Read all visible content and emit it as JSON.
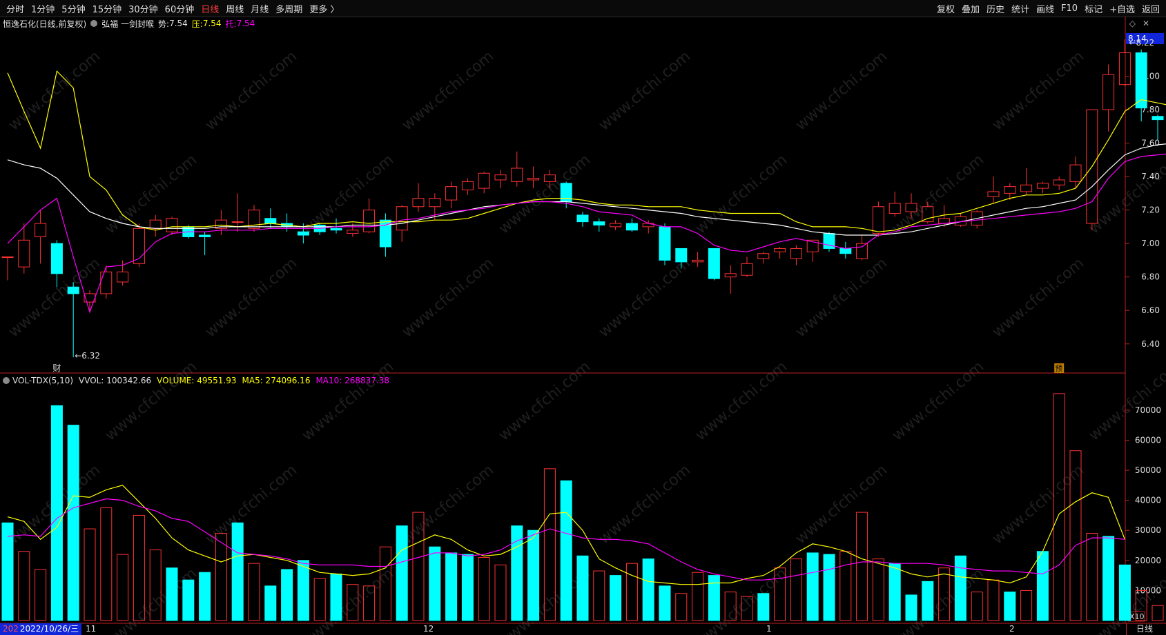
{
  "toolbar": {
    "left": [
      {
        "label": "分时"
      },
      {
        "label": "1分钟"
      },
      {
        "label": "5分钟"
      },
      {
        "label": "15分钟"
      },
      {
        "label": "30分钟"
      },
      {
        "label": "60分钟"
      },
      {
        "label": "日线",
        "active": true
      },
      {
        "label": "周线"
      },
      {
        "label": "月线"
      },
      {
        "label": "多周期"
      },
      {
        "label": "更多 〉"
      }
    ],
    "right": [
      {
        "label": "复权"
      },
      {
        "label": "叠加"
      },
      {
        "label": "历史"
      },
      {
        "label": "统计"
      },
      {
        "label": "画线"
      },
      {
        "label": "F10"
      },
      {
        "label": "标记"
      },
      {
        "label": "+自选"
      },
      {
        "label": "返回"
      }
    ]
  },
  "info": {
    "stock_title": "恒逸石化(日线,前复权)",
    "indicator": "弘福 一剑封喉",
    "shi_label": "势:",
    "shi_value": "7.54",
    "ya_label": "压:",
    "ya_value": "7.54",
    "tuo_label": "托:",
    "tuo_value": "7.54"
  },
  "volume_info": {
    "name": "VOL-TDX(5,10)",
    "vvol": "VVOL: 100342.66",
    "volume": "VOLUME: 49551.93",
    "ma5": "MA5: 274096.16",
    "ma10": "MA10: 268837.38"
  },
  "current_price": "8.14",
  "markers": {
    "high_label": "8.22",
    "low_label": "6.32",
    "cai_label": "财",
    "yu_label": "预"
  },
  "volume_unit": "X10",
  "date_strip": {
    "flag": "2022/10/26/三",
    "m_nov": "11",
    "m_dec": "12",
    "m_jan": "1",
    "m_feb": "2",
    "prefix": "202"
  },
  "period_label": "日线",
  "watermark": "www.cfchi.com",
  "colors": {
    "up": "#ff3232",
    "down": "#00ffff",
    "ma_yellow": "#ffff00",
    "ma_white": "#ffffff",
    "ma_magenta": "#ff00ff",
    "axis": "#c02020",
    "accent_blue": "#1026d8"
  },
  "chart_data": [
    {
      "type": "candlestick",
      "title": "恒逸石化(日线,前复权)",
      "price_axis": {
        "ticks": [
          6.4,
          6.6,
          6.8,
          7.0,
          7.2,
          7.4,
          7.6,
          7.8,
          8.0
        ],
        "range": [
          6.23,
          8.27
        ]
      },
      "candles": [
        {
          "o": 6.92,
          "h": 6.92,
          "l": 6.78,
          "c": 6.92
        },
        {
          "o": 6.86,
          "h": 7.12,
          "l": 6.82,
          "c": 7.02
        },
        {
          "o": 7.04,
          "h": 7.2,
          "l": 6.88,
          "c": 7.12
        },
        {
          "o": 7.0,
          "h": 7.02,
          "l": 6.74,
          "c": 6.82
        },
        {
          "o": 6.74,
          "h": 6.77,
          "l": 6.32,
          "c": 6.7
        },
        {
          "o": 6.65,
          "h": 6.72,
          "l": 6.6,
          "c": 6.7
        },
        {
          "o": 6.7,
          "h": 6.87,
          "l": 6.67,
          "c": 6.83
        },
        {
          "o": 6.77,
          "h": 6.9,
          "l": 6.75,
          "c": 6.83
        },
        {
          "o": 6.88,
          "h": 7.12,
          "l": 6.86,
          "c": 7.09
        },
        {
          "o": 7.09,
          "h": 7.17,
          "l": 7.04,
          "c": 7.14
        },
        {
          "o": 7.07,
          "h": 7.16,
          "l": 7.05,
          "c": 7.15
        },
        {
          "o": 7.1,
          "h": 7.11,
          "l": 7.03,
          "c": 7.04
        },
        {
          "o": 7.05,
          "h": 7.07,
          "l": 6.93,
          "c": 7.04
        },
        {
          "o": 7.09,
          "h": 7.2,
          "l": 7.05,
          "c": 7.14
        },
        {
          "o": 7.13,
          "h": 7.3,
          "l": 7.07,
          "c": 7.13
        },
        {
          "o": 7.09,
          "h": 7.23,
          "l": 7.07,
          "c": 7.2
        },
        {
          "o": 7.15,
          "h": 7.21,
          "l": 7.09,
          "c": 7.12
        },
        {
          "o": 7.12,
          "h": 7.18,
          "l": 7.07,
          "c": 7.1
        },
        {
          "o": 7.07,
          "h": 7.12,
          "l": 7.0,
          "c": 7.05
        },
        {
          "o": 7.11,
          "h": 7.12,
          "l": 7.05,
          "c": 7.07
        },
        {
          "o": 7.09,
          "h": 7.15,
          "l": 7.06,
          "c": 7.08
        },
        {
          "o": 7.06,
          "h": 7.12,
          "l": 7.04,
          "c": 7.08
        },
        {
          "o": 7.07,
          "h": 7.27,
          "l": 7.06,
          "c": 7.2
        },
        {
          "o": 7.14,
          "h": 7.18,
          "l": 6.92,
          "c": 6.98
        },
        {
          "o": 7.08,
          "h": 7.23,
          "l": 7.01,
          "c": 7.22
        },
        {
          "o": 7.22,
          "h": 7.36,
          "l": 7.19,
          "c": 7.27
        },
        {
          "o": 7.22,
          "h": 7.3,
          "l": 7.14,
          "c": 7.27
        },
        {
          "o": 7.26,
          "h": 7.37,
          "l": 7.21,
          "c": 7.34
        },
        {
          "o": 7.32,
          "h": 7.39,
          "l": 7.29,
          "c": 7.37
        },
        {
          "o": 7.33,
          "h": 7.43,
          "l": 7.3,
          "c": 7.42
        },
        {
          "o": 7.38,
          "h": 7.44,
          "l": 7.33,
          "c": 7.41
        },
        {
          "o": 7.37,
          "h": 7.55,
          "l": 7.34,
          "c": 7.45
        },
        {
          "o": 7.38,
          "h": 7.46,
          "l": 7.33,
          "c": 7.39
        },
        {
          "o": 7.37,
          "h": 7.44,
          "l": 7.33,
          "c": 7.41
        },
        {
          "o": 7.36,
          "h": 7.37,
          "l": 7.21,
          "c": 7.25
        },
        {
          "o": 7.17,
          "h": 7.19,
          "l": 7.1,
          "c": 7.13
        },
        {
          "o": 7.13,
          "h": 7.15,
          "l": 7.07,
          "c": 7.11
        },
        {
          "o": 7.1,
          "h": 7.14,
          "l": 7.08,
          "c": 7.12
        },
        {
          "o": 7.12,
          "h": 7.15,
          "l": 7.07,
          "c": 7.08
        },
        {
          "o": 7.1,
          "h": 7.14,
          "l": 7.06,
          "c": 7.12
        },
        {
          "o": 7.1,
          "h": 7.12,
          "l": 6.87,
          "c": 6.9
        },
        {
          "o": 6.97,
          "h": 6.97,
          "l": 6.85,
          "c": 6.89
        },
        {
          "o": 6.89,
          "h": 6.95,
          "l": 6.86,
          "c": 6.9
        },
        {
          "o": 6.97,
          "h": 6.97,
          "l": 6.78,
          "c": 6.79
        },
        {
          "o": 6.8,
          "h": 6.87,
          "l": 6.7,
          "c": 6.82
        },
        {
          "o": 6.81,
          "h": 6.92,
          "l": 6.8,
          "c": 6.88
        },
        {
          "o": 6.91,
          "h": 6.95,
          "l": 6.88,
          "c": 6.94
        },
        {
          "o": 6.95,
          "h": 6.98,
          "l": 6.91,
          "c": 6.97
        },
        {
          "o": 6.91,
          "h": 6.99,
          "l": 6.87,
          "c": 6.97
        },
        {
          "o": 6.95,
          "h": 7.02,
          "l": 6.89,
          "c": 7.02
        },
        {
          "o": 7.06,
          "h": 7.07,
          "l": 6.95,
          "c": 6.97
        },
        {
          "o": 6.97,
          "h": 7.01,
          "l": 6.91,
          "c": 6.94
        },
        {
          "o": 6.91,
          "h": 7.05,
          "l": 6.9,
          "c": 7.0
        },
        {
          "o": 7.06,
          "h": 7.25,
          "l": 7.04,
          "c": 7.22
        },
        {
          "o": 7.18,
          "h": 7.31,
          "l": 7.16,
          "c": 7.24
        },
        {
          "o": 7.19,
          "h": 7.3,
          "l": 7.15,
          "c": 7.24
        },
        {
          "o": 7.13,
          "h": 7.25,
          "l": 7.12,
          "c": 7.22
        },
        {
          "o": 7.12,
          "h": 7.23,
          "l": 7.1,
          "c": 7.15
        },
        {
          "o": 7.11,
          "h": 7.18,
          "l": 7.1,
          "c": 7.16
        },
        {
          "o": 7.11,
          "h": 7.2,
          "l": 7.09,
          "c": 7.19
        },
        {
          "o": 7.28,
          "h": 7.4,
          "l": 7.24,
          "c": 7.31
        },
        {
          "o": 7.3,
          "h": 7.36,
          "l": 7.26,
          "c": 7.34
        },
        {
          "o": 7.31,
          "h": 7.45,
          "l": 7.29,
          "c": 7.35
        },
        {
          "o": 7.33,
          "h": 7.37,
          "l": 7.3,
          "c": 7.36
        },
        {
          "o": 7.35,
          "h": 7.4,
          "l": 7.32,
          "c": 7.38
        },
        {
          "o": 7.37,
          "h": 7.52,
          "l": 7.33,
          "c": 7.47
        },
        {
          "o": 7.12,
          "h": 7.8,
          "l": 7.08,
          "c": 7.8
        },
        {
          "o": 7.8,
          "h": 8.07,
          "l": 7.67,
          "c": 8.01
        },
        {
          "o": 7.95,
          "h": 8.22,
          "l": 7.94,
          "c": 8.14
        },
        {
          "o": 8.14,
          "h": 8.16,
          "l": 7.73,
          "c": 7.81
        },
        {
          "o": 7.76,
          "h": 7.77,
          "l": 7.62,
          "c": 7.74
        },
        {
          "o": 7.74,
          "h": 7.79,
          "l": 7.69,
          "c": 7.74
        }
      ],
      "ma_yellow": [
        8.02,
        7.79,
        7.57,
        8.03,
        7.93,
        7.4,
        7.32,
        7.17,
        7.1,
        7.08,
        7.1,
        7.1,
        7.1,
        7.11,
        7.1,
        7.11,
        7.12,
        7.11,
        7.1,
        7.12,
        7.12,
        7.13,
        7.12,
        7.13,
        7.13,
        7.13,
        7.14,
        7.14,
        7.15,
        7.18,
        7.21,
        7.24,
        7.26,
        7.27,
        7.27,
        7.26,
        7.24,
        7.23,
        7.23,
        7.22,
        7.22,
        7.22,
        7.2,
        7.19,
        7.18,
        7.18,
        7.18,
        7.18,
        7.13,
        7.1,
        7.1,
        7.1,
        7.09,
        7.07,
        7.08,
        7.11,
        7.15,
        7.17,
        7.18,
        7.21,
        7.24,
        7.27,
        7.29,
        7.29,
        7.3,
        7.33,
        7.46,
        7.62,
        7.79,
        7.86,
        7.84,
        7.82
      ],
      "ma_white": [
        7.5,
        7.47,
        7.45,
        7.39,
        7.29,
        7.19,
        7.15,
        7.12,
        7.1,
        7.09,
        7.09,
        7.09,
        7.09,
        7.1,
        7.1,
        7.1,
        7.1,
        7.1,
        7.1,
        7.1,
        7.1,
        7.11,
        7.11,
        7.11,
        7.12,
        7.14,
        7.16,
        7.18,
        7.2,
        7.22,
        7.23,
        7.24,
        7.25,
        7.25,
        7.25,
        7.24,
        7.23,
        7.22,
        7.21,
        7.2,
        7.19,
        7.18,
        7.16,
        7.15,
        7.14,
        7.13,
        7.12,
        7.11,
        7.09,
        7.07,
        7.06,
        7.05,
        7.05,
        7.05,
        7.06,
        7.07,
        7.09,
        7.11,
        7.13,
        7.15,
        7.17,
        7.19,
        7.21,
        7.22,
        7.24,
        7.26,
        7.34,
        7.44,
        7.53,
        7.57,
        7.59,
        7.6
      ],
      "ma_magenta": [
        7.0,
        7.1,
        7.2,
        7.27,
        6.92,
        6.59,
        6.86,
        6.87,
        6.91,
        7.01,
        7.06,
        7.07,
        7.07,
        7.08,
        7.08,
        7.08,
        7.09,
        7.09,
        7.09,
        7.09,
        7.1,
        7.1,
        7.1,
        7.11,
        7.14,
        7.15,
        7.17,
        7.19,
        7.2,
        7.21,
        7.23,
        7.24,
        7.25,
        7.25,
        7.24,
        7.22,
        7.19,
        7.18,
        7.17,
        7.12,
        7.1,
        7.1,
        7.06,
        6.99,
        6.96,
        6.95,
        6.98,
        7.01,
        7.03,
        7.01,
        6.99,
        6.97,
        6.98,
        7.05,
        7.07,
        7.1,
        7.11,
        7.12,
        7.13,
        7.14,
        7.15,
        7.16,
        7.17,
        7.18,
        7.19,
        7.21,
        7.25,
        7.39,
        7.49,
        7.52,
        7.53,
        7.54
      ]
    },
    {
      "type": "bar",
      "title": "VOL-TDX(5,10)",
      "y_axis": {
        "ticks": [
          10000,
          20000,
          30000,
          40000,
          50000,
          60000,
          70000
        ],
        "range": [
          0,
          78000
        ]
      },
      "volume": [
        32500,
        23000,
        17000,
        71500,
        65000,
        30500,
        37500,
        22000,
        35000,
        23500,
        17500,
        13500,
        16000,
        29000,
        32500,
        19000,
        11500,
        17000,
        20000,
        14000,
        15500,
        12000,
        11500,
        24500,
        31500,
        36000,
        24500,
        22500,
        22000,
        21000,
        18500,
        31500,
        30000,
        50500,
        46500,
        21500,
        16500,
        15000,
        19000,
        20500,
        11500,
        9000,
        16000,
        15000,
        9500,
        8000,
        9000,
        17500,
        20500,
        22500,
        22000,
        23000,
        36000,
        20500,
        19000,
        8500,
        13000,
        17500,
        21500,
        9500,
        13500,
        9500,
        10000,
        23000,
        75500,
        56500,
        29000,
        28000,
        18500,
        10000,
        5000
      ],
      "volume_direction": [
        "down",
        "up",
        "up",
        "down",
        "down",
        "up",
        "up",
        "up",
        "up",
        "up",
        "down",
        "down",
        "down",
        "up",
        "down",
        "up",
        "down",
        "down",
        "down",
        "up",
        "down",
        "up",
        "up",
        "up",
        "down",
        "up",
        "down",
        "down",
        "down",
        "up",
        "up",
        "down",
        "down",
        "up",
        "down",
        "down",
        "up",
        "down",
        "up",
        "down",
        "down",
        "up",
        "up",
        "down",
        "up",
        "up",
        "down",
        "up",
        "up",
        "down",
        "down",
        "up",
        "up",
        "up",
        "down",
        "down",
        "down",
        "up",
        "down",
        "up",
        "up",
        "down",
        "up",
        "down",
        "up",
        "up",
        "up",
        "down",
        "down",
        "up",
        "up"
      ],
      "ma_yellow": [
        34500,
        33000,
        27000,
        31000,
        41500,
        41000,
        43500,
        45000,
        39500,
        34000,
        27500,
        23500,
        21500,
        19500,
        21500,
        22000,
        21000,
        20000,
        18000,
        16000,
        15500,
        15000,
        15500,
        17500,
        23500,
        26000,
        28500,
        27000,
        23500,
        21500,
        22000,
        24500,
        27500,
        35500,
        36000,
        30000,
        20500,
        17500,
        15000,
        13000,
        12500,
        12000,
        12000,
        12500,
        12500,
        14000,
        15000,
        18000,
        22500,
        25500,
        24500,
        23000,
        20500,
        19000,
        17500,
        15500,
        14500,
        15500,
        14500,
        14000,
        13500,
        12500,
        14500,
        23000,
        35500,
        39500,
        42500,
        41000,
        27000
      ],
      "ma_magenta": [
        28000,
        28500,
        28000,
        34000,
        37500,
        39000,
        40500,
        40000,
        38000,
        36500,
        34000,
        33000,
        29500,
        26000,
        22500,
        22000,
        21500,
        20500,
        19000,
        18500,
        18500,
        18500,
        18000,
        18000,
        19500,
        21000,
        22500,
        22500,
        21500,
        22000,
        23500,
        26500,
        28500,
        30500,
        29000,
        27500,
        27000,
        27000,
        26500,
        25500,
        22500,
        19500,
        17000,
        15500,
        14500,
        13500,
        13500,
        14000,
        15000,
        16000,
        17000,
        18500,
        19500,
        19500,
        19000,
        19000,
        19000,
        18500,
        17500,
        17000,
        16500,
        16500,
        16000,
        15500,
        18500,
        25000,
        27500,
        27500,
        27000
      ]
    }
  ]
}
